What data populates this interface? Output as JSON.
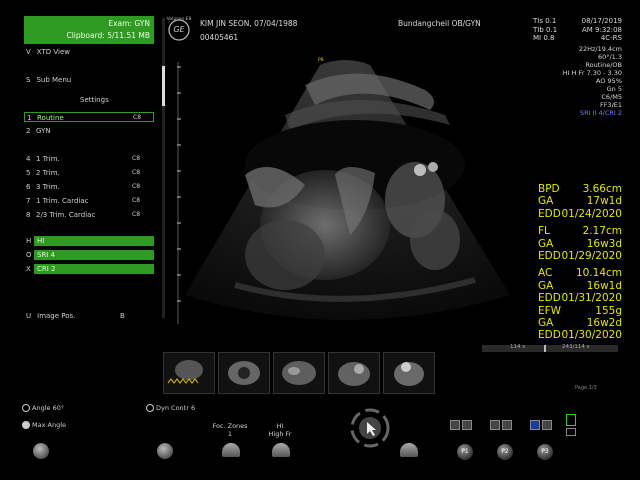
{
  "exam": {
    "exam_label": "Exam:  GYN",
    "clipboard_label": "Clipboard:  5/11.51 MB"
  },
  "logo": "GE",
  "logo_small": "Voluson E8",
  "patient": {
    "name_dob": "KIM JIN SEON,  07/04/1988",
    "id": "00405461"
  },
  "hospital": "Bundangcheil OB/GYN",
  "right_info": {
    "tis": "TIs 0.1",
    "tib": "TIb 0.1",
    "mi": "MI 0.8",
    "date": "08/17/2019",
    "time": "AM 9:32:08",
    "probe": "4C-RS",
    "params": [
      "22Hz/19.4cm",
      "60°/1.3",
      "Routine/OB",
      "HI H Fr 7.30 - 3.30",
      "AO 95%",
      "Gn  5",
      "C6/M5",
      "FF3/E1"
    ],
    "sri_cri": "SRI II 4/CRI 2"
  },
  "menu": {
    "xtd_view": "XTD View",
    "sub_menu": "Sub Menu",
    "settings": "Settings",
    "items": [
      {
        "key": "1",
        "label": "Routine",
        "value": "C8"
      },
      {
        "key": "2",
        "label": "GYN",
        "value": ""
      },
      {
        "key": "4",
        "label": "1 Trim.",
        "value": "C8"
      },
      {
        "key": "5",
        "label": "2 Trim.",
        "value": "C8"
      },
      {
        "key": "6",
        "label": "3 Trim.",
        "value": "C8"
      },
      {
        "key": "7",
        "label": "1 Trim. Cardiac",
        "value": "C8"
      },
      {
        "key": "8",
        "label": "2/3 Trim. Cardiac",
        "value": "C8"
      }
    ],
    "toggles": [
      {
        "key": "H",
        "label": "HI"
      },
      {
        "key": "O",
        "label": "SRI 4"
      },
      {
        "key": "X",
        "label": "CRI 2"
      }
    ],
    "image_pos_label": "Image Pos.",
    "image_pos_value": "B"
  },
  "measurements": [
    {
      "label": "BPD",
      "value": "3.66cm"
    },
    {
      "label": "GA",
      "value": "17w1d"
    },
    {
      "label": "EDD",
      "value": "01/24/2020"
    },
    {
      "label": "FL",
      "value": "2.17cm"
    },
    {
      "label": "GA",
      "value": "16w3d"
    },
    {
      "label": "EDD",
      "value": "01/29/2020"
    },
    {
      "label": "AC",
      "value": "10.14cm"
    },
    {
      "label": "GA",
      "value": "16w1d"
    },
    {
      "label": "EDD",
      "value": "01/31/2020"
    },
    {
      "label": "EFW",
      "value": "155g"
    },
    {
      "label": "GA",
      "value": "16w2d"
    },
    {
      "label": "EDD",
      "value": "01/30/2020"
    }
  ],
  "cine": {
    "frame": "114 s",
    "total": "243/114 s",
    "page": "Page 1/3"
  },
  "scale_marker": "P8",
  "bottom": {
    "angle": "Angle 60°",
    "max_angle": "Max Angle",
    "dyn_contrast": "Dyn Contr 6",
    "foc_zones_label": "Foc. Zones",
    "foc_zones_value": "1",
    "hi_label": "HI",
    "hi_value": "High Fr",
    "p1": "P1",
    "p2": "P2",
    "p3": "P3"
  }
}
